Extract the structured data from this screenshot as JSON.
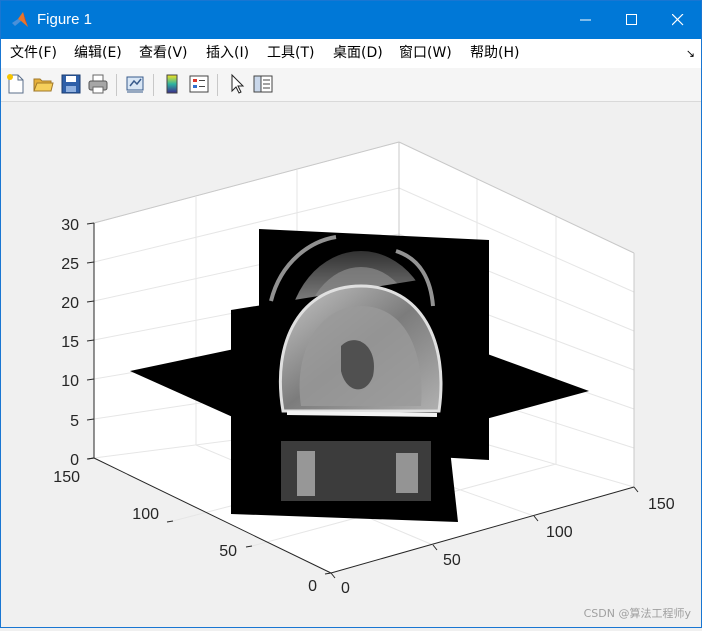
{
  "window": {
    "title": "Figure 1",
    "controls": {
      "minimize": "—",
      "maximize": "☐",
      "close": "✕"
    }
  },
  "menu": {
    "items": [
      "文件(F)",
      "编辑(E)",
      "查看(V)",
      "插入(I)",
      "工具(T)",
      "桌面(D)",
      "窗口(W)",
      "帮助(H)"
    ],
    "dock_glyph": "↘"
  },
  "toolbar": {
    "buttons": [
      "new-figure-icon",
      "open-file-icon",
      "save-icon",
      "print-icon",
      "link-plot-icon",
      "colorbar-icon",
      "legend-icon",
      "edit-plot-cursor-icon",
      "property-inspector-icon"
    ]
  },
  "plot": {
    "z_ticks": [
      "0",
      "5",
      "10",
      "15",
      "20",
      "25",
      "30"
    ],
    "y_ticks": [
      "0",
      "50",
      "100",
      "150"
    ],
    "x_ticks": [
      "0",
      "50",
      "100",
      "150"
    ]
  },
  "watermark": "CSDN @算法工程师y"
}
